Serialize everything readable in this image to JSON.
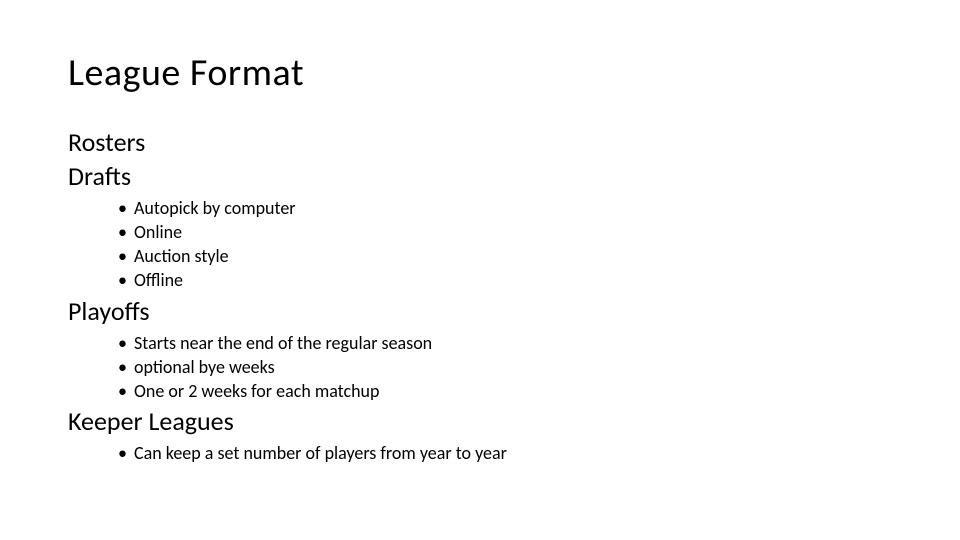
{
  "title": "League Format",
  "sections": {
    "rosters": {
      "heading": "Rosters"
    },
    "drafts": {
      "heading": "Drafts",
      "bullets": [
        "Autopick by computer",
        "Online",
        "Auction style",
        "Offline"
      ]
    },
    "playoffs": {
      "heading": "Playoffs",
      "bullets": [
        "Starts near the end of the regular season",
        "optional bye weeks",
        "One or 2 weeks for each matchup"
      ]
    },
    "keeper": {
      "heading": "Keeper Leagues",
      "bullets": [
        "Can keep a set number of players from year to year"
      ]
    }
  }
}
